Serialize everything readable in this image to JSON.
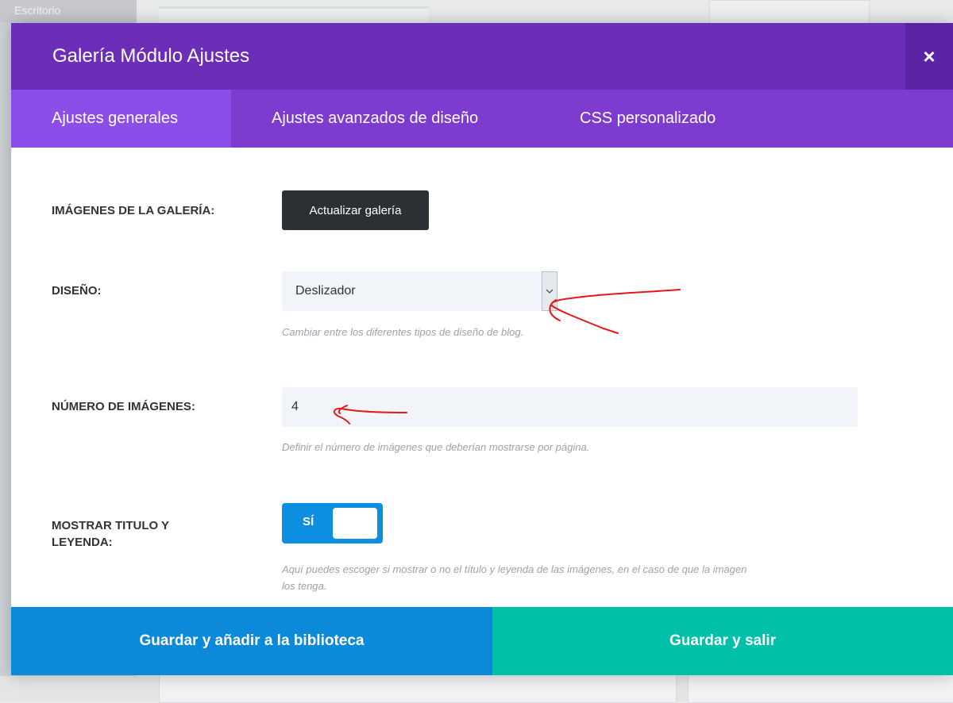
{
  "background": {
    "desk_label": "Escritorio"
  },
  "modal": {
    "title": "Galería Módulo Ajustes",
    "close_symbol": "×",
    "tabs": [
      {
        "label": "Ajustes generales",
        "active": true
      },
      {
        "label": "Ajustes avanzados de diseño",
        "active": false
      },
      {
        "label": "CSS personalizado",
        "active": false
      }
    ]
  },
  "fields": {
    "gallery": {
      "label": "IMÁGENES DE LA GALERÍA:",
      "button": "Actualizar galería"
    },
    "design": {
      "label": "DISEÑO:",
      "value": "Deslizador",
      "help": "Cambiar entre los diferentes tipos de diseño de blog."
    },
    "count": {
      "label": "NÚMERO DE IMÁGENES:",
      "value": "4",
      "help": "Definir el número de imágenes que deberían mostrarse por página."
    },
    "show_title": {
      "label_line1": "MOSTRAR TITULO Y",
      "label_line2": "LEYENDA:",
      "toggle_text": "SÍ",
      "enabled": true,
      "help_line1": "Aquí puedes escoger si mostrar o no el título y leyenda de las imágenes, en el caso de que la imagen",
      "help_line2": "los tenga."
    }
  },
  "footer": {
    "library_button": "Guardar y añadir a la biblioteca",
    "save_button": "Guardar y salir"
  },
  "colors": {
    "header": "#6c2eb9",
    "tabs": "#7d3ccf",
    "active_tab": "#8d4de8",
    "toggle": "#0c8fe0",
    "library_button": "#0c8ad9",
    "save_button": "#00c1a8",
    "annotation": "#e8161b"
  }
}
